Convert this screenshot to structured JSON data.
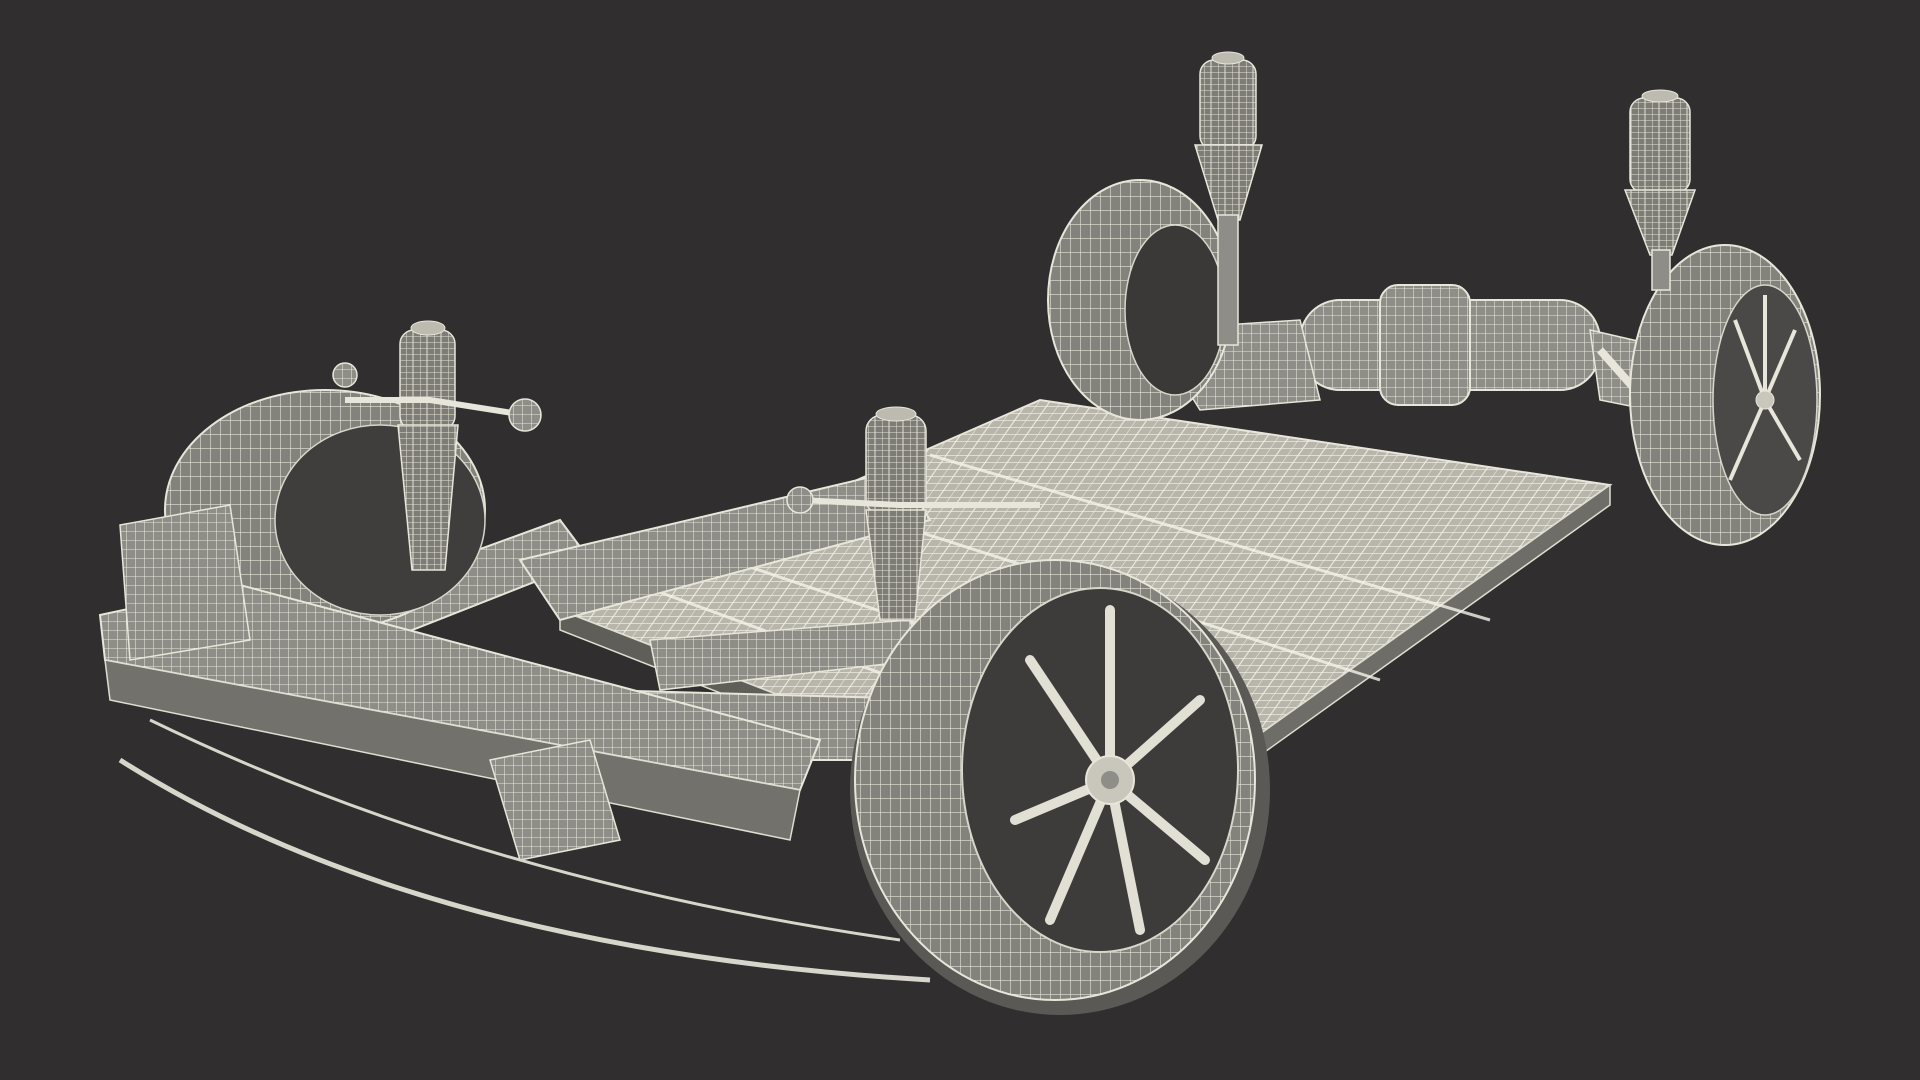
{
  "scene": {
    "subject": "chassis-wireframe",
    "background_color": "#302e2e",
    "wire_color": "#e4e2d6",
    "surface_color": "#8c8b85",
    "shadow_color": "#5a5955"
  }
}
